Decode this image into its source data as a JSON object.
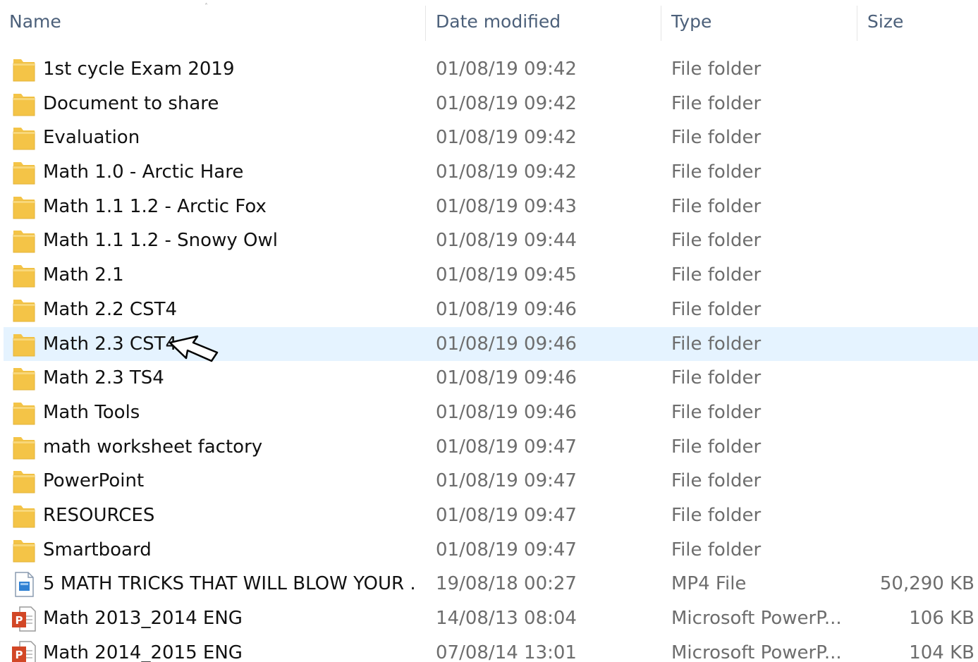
{
  "columns": {
    "name": "Name",
    "date": "Date modified",
    "type": "Type",
    "size": "Size"
  },
  "colors": {
    "header_text": "#4c607a",
    "selection": "#e5f3ff",
    "folder": "#f4c447",
    "ppt": "#d24726"
  },
  "files": [
    {
      "name": "1st cycle Exam 2019",
      "date": "01/08/19 09:42",
      "type": "File folder",
      "size": "",
      "icon": "folder-icon",
      "selected": false
    },
    {
      "name": "Document to share",
      "date": "01/08/19 09:42",
      "type": "File folder",
      "size": "",
      "icon": "folder-icon",
      "selected": false
    },
    {
      "name": "Evaluation",
      "date": "01/08/19 09:42",
      "type": "File folder",
      "size": "",
      "icon": "folder-icon",
      "selected": false
    },
    {
      "name": "Math 1.0 - Arctic Hare",
      "date": "01/08/19 09:42",
      "type": "File folder",
      "size": "",
      "icon": "folder-icon",
      "selected": false
    },
    {
      "name": "Math 1.1 1.2 - Arctic Fox",
      "date": "01/08/19 09:43",
      "type": "File folder",
      "size": "",
      "icon": "folder-icon",
      "selected": false
    },
    {
      "name": "Math 1.1 1.2 - Snowy Owl",
      "date": "01/08/19 09:44",
      "type": "File folder",
      "size": "",
      "icon": "folder-icon",
      "selected": false
    },
    {
      "name": "Math 2.1",
      "date": "01/08/19 09:45",
      "type": "File folder",
      "size": "",
      "icon": "folder-icon",
      "selected": false
    },
    {
      "name": "Math 2.2 CST4",
      "date": "01/08/19 09:46",
      "type": "File folder",
      "size": "",
      "icon": "folder-icon",
      "selected": false
    },
    {
      "name": "Math 2.3 CST4",
      "date": "01/08/19 09:46",
      "type": "File folder",
      "size": "",
      "icon": "folder-icon",
      "selected": true
    },
    {
      "name": "Math 2.3 TS4",
      "date": "01/08/19 09:46",
      "type": "File folder",
      "size": "",
      "icon": "folder-icon",
      "selected": false
    },
    {
      "name": "Math Tools",
      "date": "01/08/19 09:46",
      "type": "File folder",
      "size": "",
      "icon": "folder-icon",
      "selected": false
    },
    {
      "name": "math worksheet factory",
      "date": "01/08/19 09:47",
      "type": "File folder",
      "size": "",
      "icon": "folder-icon",
      "selected": false
    },
    {
      "name": "PowerPoint",
      "date": "01/08/19 09:47",
      "type": "File folder",
      "size": "",
      "icon": "folder-icon",
      "selected": false
    },
    {
      "name": "RESOURCES",
      "date": "01/08/19 09:47",
      "type": "File folder",
      "size": "",
      "icon": "folder-icon",
      "selected": false
    },
    {
      "name": "Smartboard",
      "date": "01/08/19 09:47",
      "type": "File folder",
      "size": "",
      "icon": "folder-icon",
      "selected": false
    },
    {
      "name": "5 MATH TRICKS THAT WILL BLOW YOUR ...",
      "date": "19/08/18 00:27",
      "type": "MP4 File",
      "size": "50,290 KB",
      "icon": "video-file-icon",
      "selected": false
    },
    {
      "name": "Math 2013_2014 ENG",
      "date": "14/08/13 08:04",
      "type": "Microsoft PowerP...",
      "size": "106 KB",
      "icon": "powerpoint-file-icon",
      "selected": false
    },
    {
      "name": "Math 2014_2015 ENG",
      "date": "07/08/14 13:01",
      "type": "Microsoft PowerP...",
      "size": "104 KB",
      "icon": "powerpoint-file-icon",
      "selected": false
    }
  ]
}
